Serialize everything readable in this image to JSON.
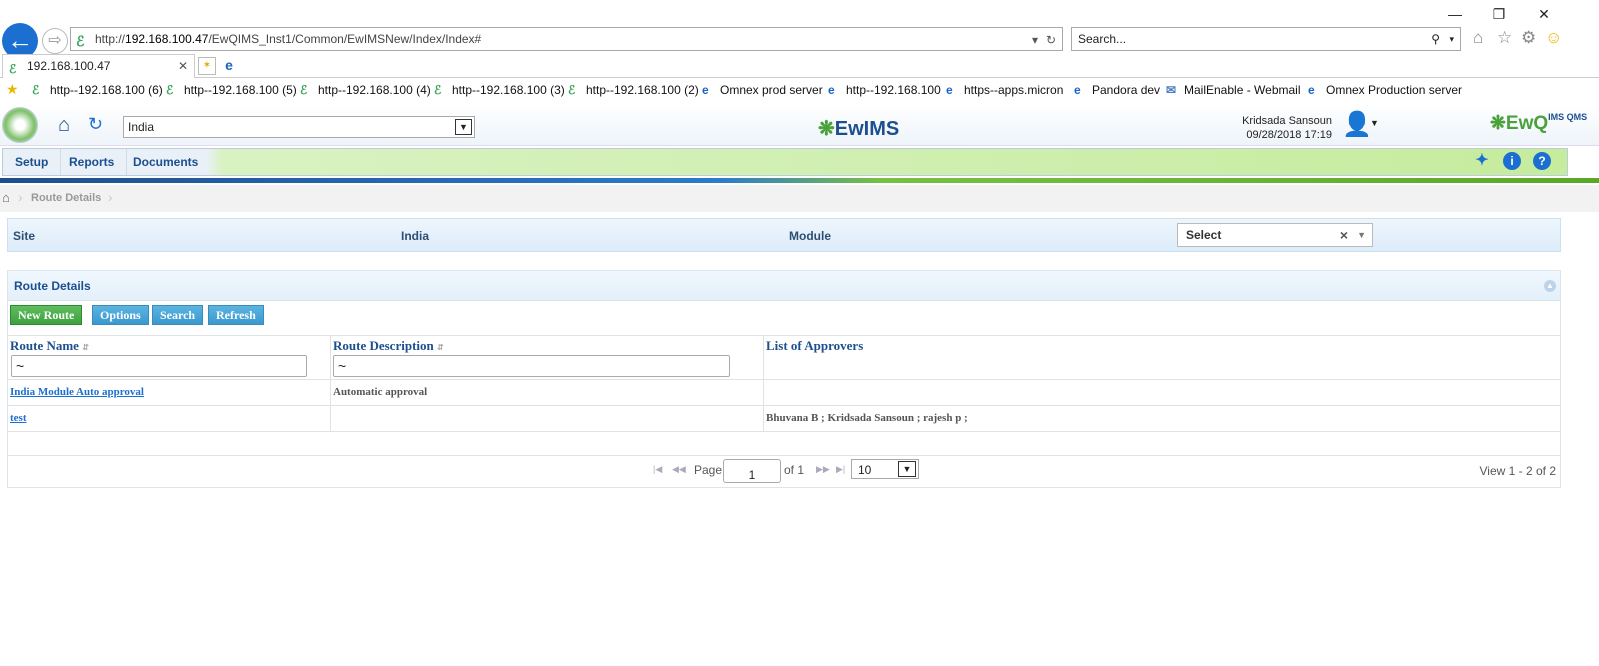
{
  "browser": {
    "url_prefix": "http://",
    "url_host": "192.168.100.47",
    "url_path": "/EwQIMS_Inst1/Common/EwIMSNew/Index/Index#",
    "search_placeholder": "Search...",
    "tab_title": "192.168.100.47",
    "window_buttons": {
      "minimize": "—",
      "restore": "❐",
      "close": "✕"
    },
    "favorites": [
      {
        "label": "http--192.168.100 (6)",
        "icon": "ew"
      },
      {
        "label": "http--192.168.100 (5)",
        "icon": "ew"
      },
      {
        "label": "http--192.168.100 (4)",
        "icon": "ew"
      },
      {
        "label": "http--192.168.100 (3)",
        "icon": "ew"
      },
      {
        "label": "http--192.168.100 (2)",
        "icon": "ew"
      },
      {
        "label": "Omnex prod server",
        "icon": "ie"
      },
      {
        "label": "http--192.168.100",
        "icon": "ie"
      },
      {
        "label": "https--apps.micron",
        "icon": "ie"
      },
      {
        "label": "Pandora dev",
        "icon": "ie"
      },
      {
        "label": "MailEnable - Webmail",
        "icon": "mail"
      },
      {
        "label": "Omnex Production server",
        "icon": "ie"
      }
    ]
  },
  "app": {
    "site_select_value": "India",
    "logo_text": "EwIMS",
    "brand_text": "EwQ",
    "brand_sub": "IMS QMS",
    "user_name": "Kridsada Sansoun",
    "user_datetime": "09/28/2018 17:19",
    "menu": [
      "Setup",
      "Reports",
      "Documents"
    ],
    "breadcrumb": "Route Details"
  },
  "filter": {
    "site_label": "Site",
    "site_value": "India",
    "module_label": "Module",
    "module_select": "Select"
  },
  "panel": {
    "title": "Route Details",
    "buttons": {
      "new_route": "New Route",
      "options": "Options",
      "search": "Search",
      "refresh": "Refresh"
    },
    "columns": {
      "route_name": "Route Name",
      "route_description": "Route Description",
      "approvers": "List of Approvers"
    },
    "filter_name": "~",
    "filter_desc": "~",
    "rows": [
      {
        "name": "India Module Auto approval",
        "description": "Automatic approval",
        "approvers": ""
      },
      {
        "name": "test",
        "description": "",
        "approvers": "Bhuvana  B ; Kridsada Sansoun ; rajesh p ;"
      }
    ],
    "pager": {
      "page_label": "Page",
      "page": "1",
      "of_label": "of 1",
      "page_size": "10",
      "view": "View 1 - 2 of 2"
    }
  }
}
